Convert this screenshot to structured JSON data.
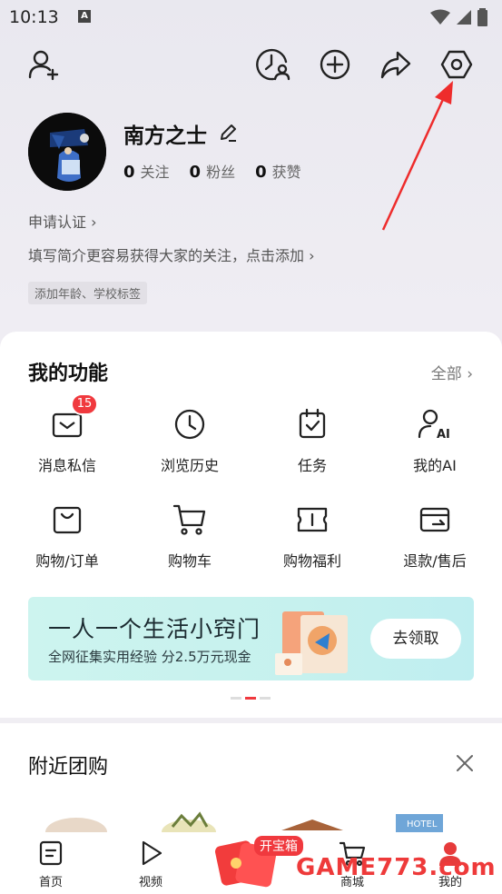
{
  "status_bar": {
    "time": "10:13",
    "indicator": "A"
  },
  "header": {
    "icons": [
      "add-friend-icon",
      "visit-history-icon",
      "create-icon",
      "share-icon",
      "settings-icon"
    ]
  },
  "profile": {
    "name": "南方之士",
    "stats": [
      {
        "count": "0",
        "label": "关注"
      },
      {
        "count": "0",
        "label": "粉丝"
      },
      {
        "count": "0",
        "label": "获赞"
      }
    ],
    "apply_cert": "申请认证 ›",
    "bio_hint": "填写简介更容易获得大家的关注，点击添加 ›",
    "tag_chip": "添加年龄、学校标签"
  },
  "functions": {
    "title": "我的功能",
    "all_label": "全部 ›",
    "items": [
      {
        "label": "消息私信",
        "icon": "mail-icon",
        "badge": "15"
      },
      {
        "label": "浏览历史",
        "icon": "clock-icon"
      },
      {
        "label": "任务",
        "icon": "calendar-check-icon"
      },
      {
        "label": "我的AI",
        "icon": "ai-person-icon"
      },
      {
        "label": "购物/订单",
        "icon": "shopping-bag-icon"
      },
      {
        "label": "购物车",
        "icon": "cart-icon"
      },
      {
        "label": "购物福利",
        "icon": "coupon-icon"
      },
      {
        "label": "退款/售后",
        "icon": "refund-card-icon"
      }
    ]
  },
  "banner": {
    "title": "一人一个生活小窍门",
    "subtitle": "全网征集实用经验 分2.5万元现金",
    "button": "去领取"
  },
  "nearby": {
    "title": "附近团购"
  },
  "bottom_nav": {
    "items": [
      {
        "label": "首页",
        "icon": "home-doc-icon"
      },
      {
        "label": "视频",
        "icon": "play-icon"
      },
      {
        "label": "",
        "icon": "red-envelope-icon"
      },
      {
        "label": "商城",
        "icon": "shop-cart-icon"
      },
      {
        "label": "我的",
        "icon": "profile-icon"
      }
    ],
    "treasure_label": "开宝箱"
  },
  "watermark": "GAME773.com",
  "colors": {
    "accent": "#f0393e",
    "banner_bg": "#c6f1ee"
  }
}
